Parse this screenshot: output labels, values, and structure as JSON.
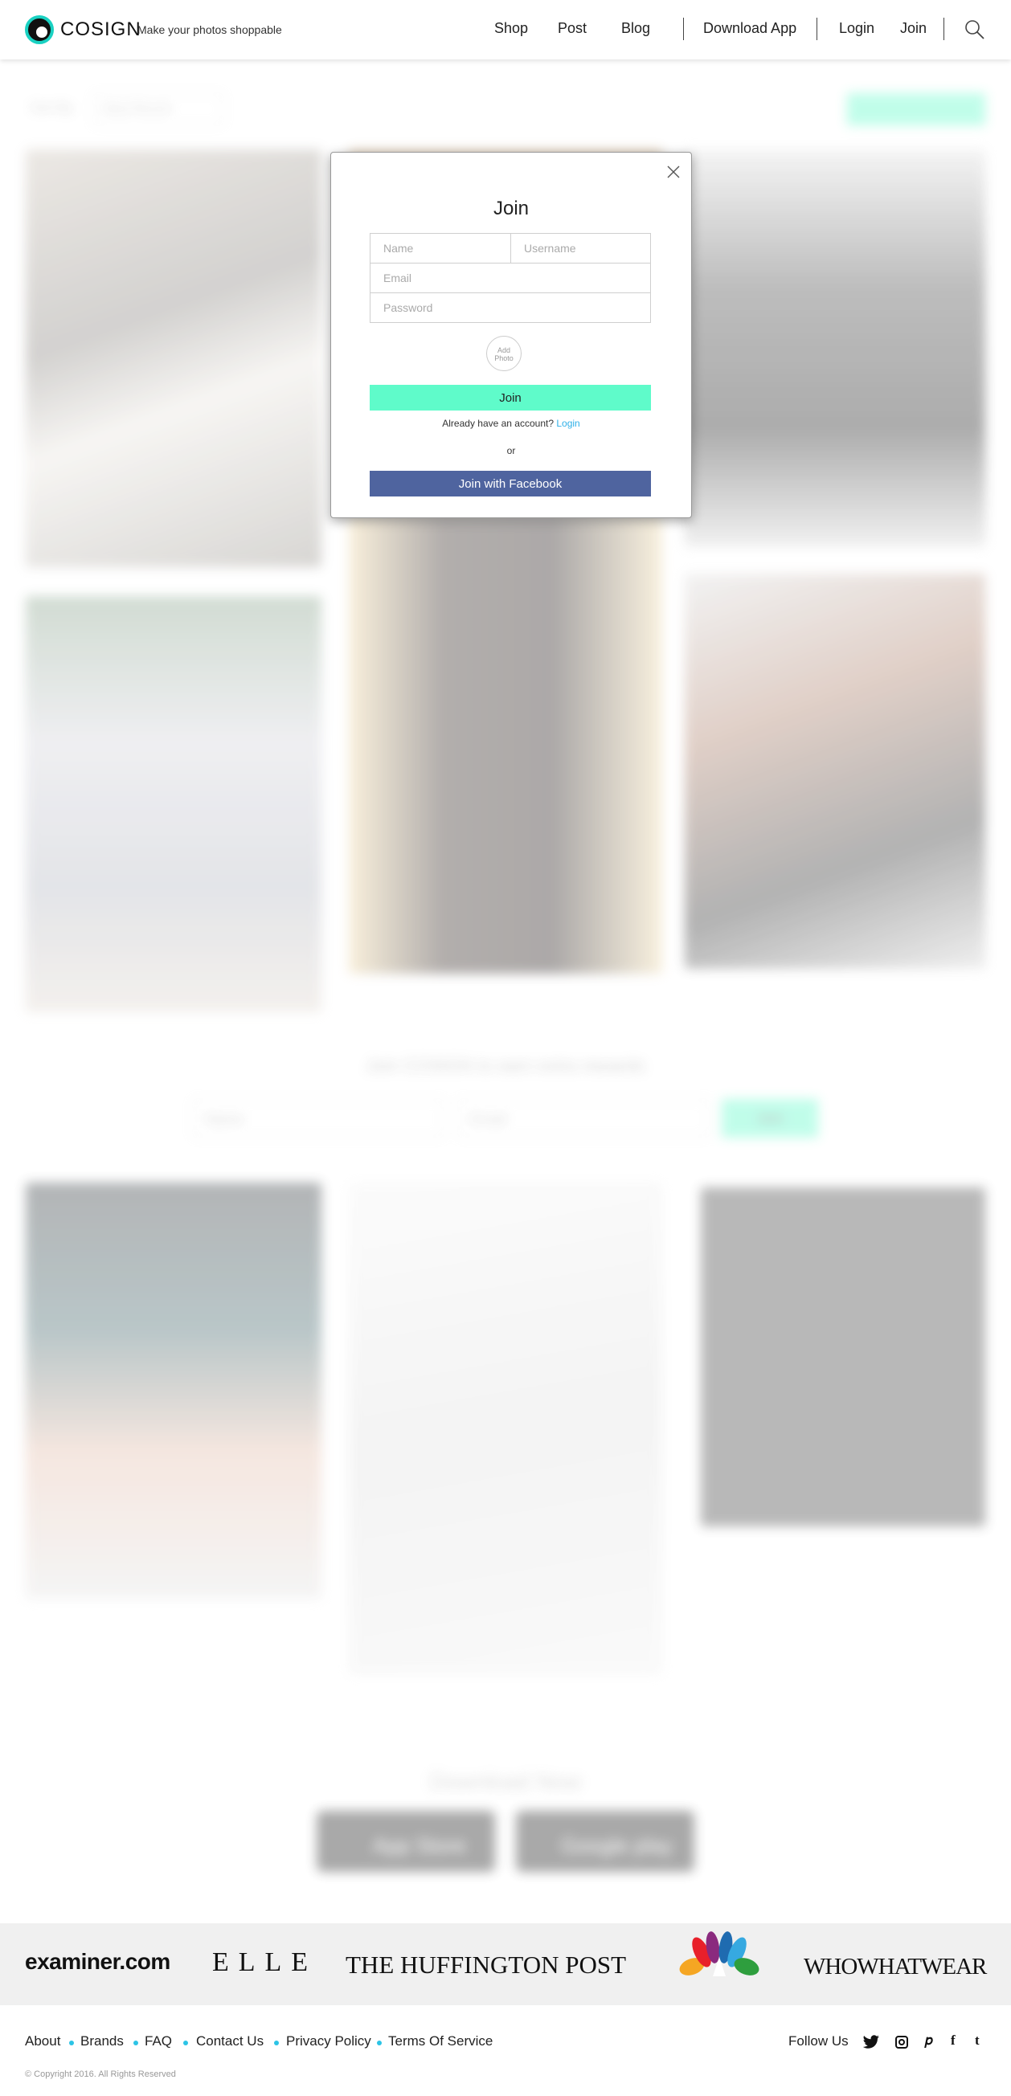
{
  "header": {
    "brand": "COSIGN",
    "tagline": "Make your photos shoppable",
    "nav": [
      "Shop",
      "Post",
      "Blog"
    ],
    "download_app": "Download App",
    "login": "Login",
    "join": "Join"
  },
  "modal": {
    "title": "Join",
    "name_placeholder": "Name",
    "username_placeholder": "Username",
    "email_placeholder": "Email",
    "password_placeholder": "Password",
    "add_photo": "Add Photo",
    "join_button": "Join",
    "already_text": "Already have an account?",
    "login_link": "Login",
    "or_text": "or",
    "facebook_button": "Join with Facebook"
  },
  "background": {
    "sort_by_label": "Sort By",
    "sort_value": "Most Recent",
    "signup_prompt": "Join COSIGN to earn extra rewards",
    "signup_name_placeholder": "Name",
    "signup_email_placeholder": "Email",
    "signup_button": "Join",
    "download_now": "Download Now",
    "app_store": "App Store",
    "google_play": "Google play"
  },
  "press": {
    "examiner": "examiner.com",
    "elle": "ELLE",
    "huffington": "THE HUFFINGTON POST",
    "nbc": "nbc-peacock-logo",
    "whowhatwear": "WHOWHATWEAR"
  },
  "footer": {
    "links": [
      "About",
      "Brands",
      "FAQ",
      "Contact Us",
      "Privacy Policy",
      "Terms Of Service"
    ],
    "follow_us": "Follow Us",
    "copyright": "© Copyright 2016. All Rights Reserved"
  },
  "colors": {
    "accent": "#5ffbca",
    "facebook": "#4f649f",
    "link": "#2fb0e8",
    "brand_ring": "#1ad1c2"
  }
}
